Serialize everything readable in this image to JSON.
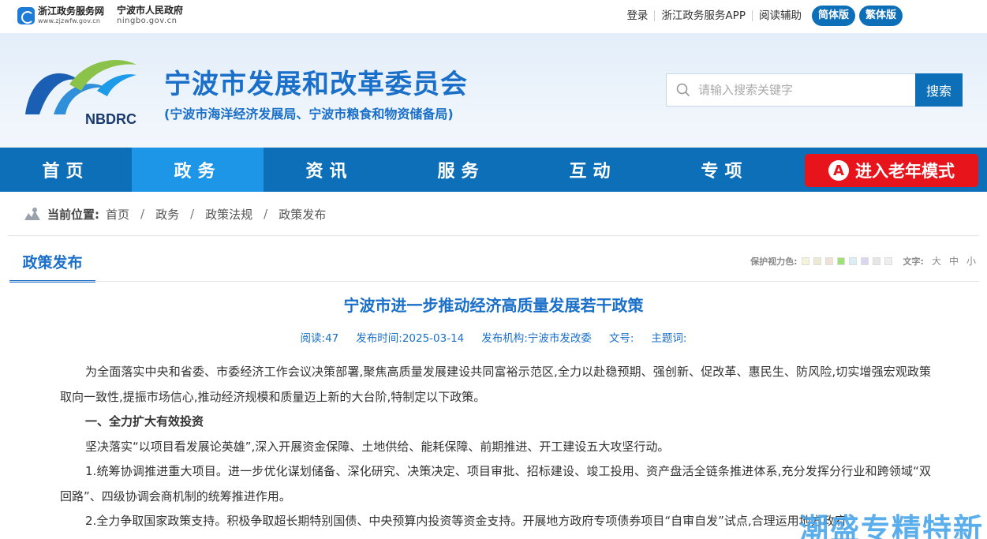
{
  "topbar": {
    "zj_name": "浙江政务服务网",
    "zj_url": "www.zjzwfw.gov.cn",
    "nb_name": "宁波市人民政府",
    "nb_url": "ningbo.gov.cn",
    "links": [
      "登录",
      "浙江政务服务APP",
      "阅读辅助"
    ],
    "simplified": "简体版",
    "traditional": "繁体版"
  },
  "header": {
    "logo_text": "NBDRC",
    "title": "宁波市发展和改革委员会",
    "subtitle": "(宁波市海洋经济发展局、宁波市粮食和物资储备局)",
    "search_placeholder": "请输入搜索关键字",
    "search_button": "搜索"
  },
  "nav": {
    "items": [
      "首页",
      "政务",
      "资讯",
      "服务",
      "互动",
      "专项"
    ],
    "active_index": 1,
    "elder_mode": "进入老年模式",
    "elder_icon_letter": "A"
  },
  "breadcrumb": {
    "label": "当前位置:",
    "items": [
      "首页",
      "政务",
      "政策法规",
      "政策发布"
    ],
    "separator": "/"
  },
  "section": {
    "title": "政策发布",
    "eye_label": "保护视力色:",
    "eye_colors": [
      "#f6f4d8",
      "#eee9d3",
      "#f2e2d6",
      "#9fe07a",
      "#dbeef8",
      "#d9d6f2",
      "#e6e6e6",
      "#efefef"
    ],
    "font_label": "文字:",
    "font_sizes": [
      "大",
      "中",
      "小"
    ]
  },
  "article": {
    "title": "宁波市进一步推动经济高质量发展若干政策",
    "meta": {
      "reads": "阅读:47",
      "published": "发布时间:2025-03-14",
      "org": "发布机构:宁波市发改委",
      "doc_no": "文号:",
      "topic": "主题词:"
    },
    "paragraphs": [
      {
        "text": "为全面落实中央和省委、市委经济工作会议决策部署,聚焦高质量发展建设共同富裕示范区,全力以赴稳预期、强创新、促改革、惠民生、防风险,切实增强宏观政策取向一致性,提振市场信心,推动经济规模和质量迈上新的大台阶,特制定以下政策。",
        "heading": false
      },
      {
        "text": "一、全力扩大有效投资",
        "heading": true
      },
      {
        "text": "坚决落实“以项目看发展论英雄”,深入开展资金保障、土地供给、能耗保障、前期推进、开工建设五大攻坚行动。",
        "heading": false
      },
      {
        "text": "1.统筹协调推进重大项目。进一步优化谋划储备、深化研究、决策决定、项目审批、招标建设、竣工投用、资产盘活全链条推进体系,充分发挥分行业和跨领域“双回路”、四级协调会商机制的统筹推进作用。",
        "heading": false
      },
      {
        "text": "2.全力争取国家政策支持。积极争取超长期特别国债、中央预算内投资等资金支持。开展地方政府专项债券项目“自审自发”试点,合理运用地方政府",
        "heading": false
      }
    ]
  },
  "watermark": "潮盛专精特新"
}
